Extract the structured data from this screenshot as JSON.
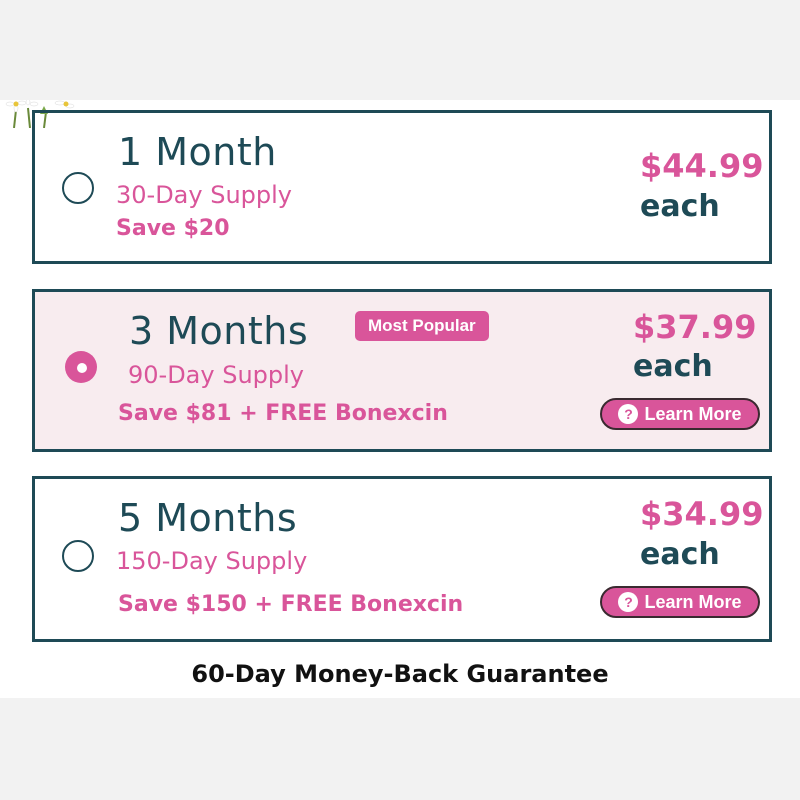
{
  "options": [
    {
      "title": "1 Month",
      "supply": "30-Day Supply",
      "save": "Save $20",
      "price": "$44.99",
      "each": "each",
      "selected": false
    },
    {
      "title": "3 Months",
      "supply": "90-Day Supply",
      "save": "Save $81 + FREE Bonexcin",
      "price": "$37.99",
      "each": "each",
      "badge": "Most Popular",
      "learn_more": "Learn More",
      "selected": true
    },
    {
      "title": "5 Months",
      "supply": "150-Day Supply",
      "save": "Save $150 + FREE Bonexcin",
      "price": "$34.99",
      "each": "each",
      "learn_more": "Learn More",
      "selected": false
    }
  ],
  "guarantee": "60-Day Money-Back Guarantee",
  "colors": {
    "accent": "#d9559a",
    "dark": "#1e4a56",
    "selected_bg": "#f8ecef",
    "page_bg": "#f2f2f2"
  },
  "icons": {
    "learn_more": "question-circle-icon",
    "decoration": "daisy-flowers-icon"
  }
}
